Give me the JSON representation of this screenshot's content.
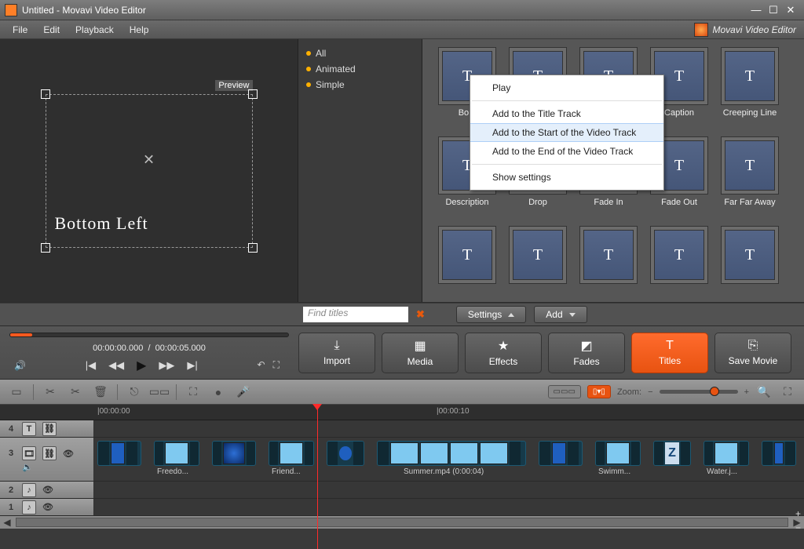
{
  "window": {
    "title": "Untitled - Movavi Video Editor"
  },
  "menu": {
    "file": "File",
    "edit": "Edit",
    "playback": "Playback",
    "help": "Help"
  },
  "brand": "Movavi Video Editor",
  "preview": {
    "badge": "Preview",
    "overlay_text": "Bottom Left"
  },
  "categories": {
    "all": "All",
    "animated": "Animated",
    "simple": "Simple"
  },
  "titles": {
    "row1": [
      "Bo...",
      "",
      "",
      "Caption",
      "Creeping Line"
    ],
    "row2": [
      "Description",
      "Drop",
      "Fade In",
      "Fade Out",
      "Far Far Away"
    ],
    "glyph": "T"
  },
  "context_menu": {
    "play": "Play",
    "add_title": "Add to the Title Track",
    "add_start": "Add to the Start of the Video Track",
    "add_end": "Add to the End of the Video Track",
    "show_settings": "Show settings"
  },
  "search": {
    "placeholder": "Find titles"
  },
  "buttons": {
    "settings": "Settings",
    "add": "Add"
  },
  "timecode": {
    "current": "00:00:00.000",
    "sep": "/",
    "total": "00:00:05.000"
  },
  "main_tabs": {
    "import": "Import",
    "media": "Media",
    "effects": "Effects",
    "fades": "Fades",
    "titles": "Titles",
    "save": "Save Movie"
  },
  "zoom_label": "Zoom:",
  "ruler": {
    "t0": "|00:00:00",
    "t10": "|00:00:10"
  },
  "tracks": {
    "n4": "4",
    "n3": "3",
    "n2": "2",
    "n1": "1"
  },
  "clips": {
    "freedo": "Freedo...",
    "friend": "Friend...",
    "summer": "Summer.mp4 (0:00:04)",
    "swimm": "Swimm...",
    "water": "Water.j..."
  }
}
